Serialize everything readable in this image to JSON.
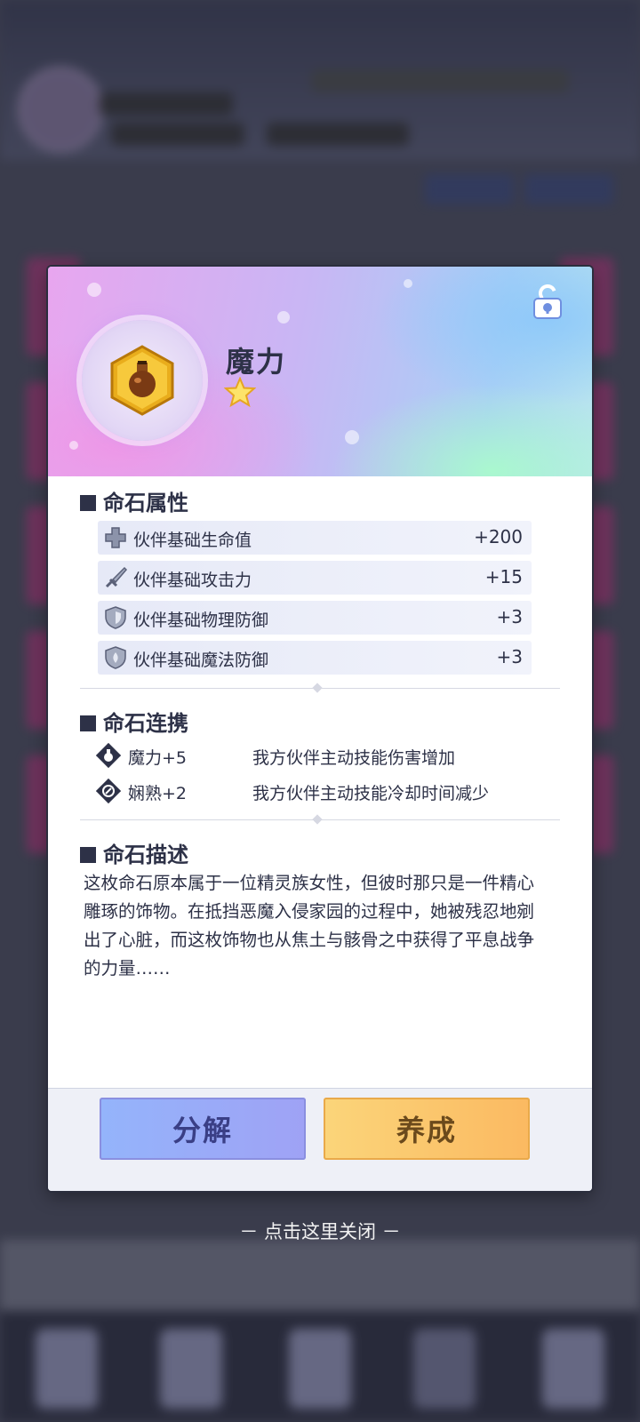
{
  "item": {
    "name": "魔力",
    "stars": 1
  },
  "sections": {
    "attributes_title": "命石属性",
    "links_title": "命石连携",
    "description_title": "命石描述"
  },
  "attributes": [
    {
      "label": "伙伴基础生命值",
      "value": "+200",
      "icon": "plus-icon"
    },
    {
      "label": "伙伴基础攻击力",
      "value": "+15",
      "icon": "sword-icon"
    },
    {
      "label": "伙伴基础物理防御",
      "value": "+3",
      "icon": "shield-icon"
    },
    {
      "label": "伙伴基础魔法防御",
      "value": "+3",
      "icon": "magic-shield-icon"
    }
  ],
  "links": [
    {
      "name": "魔力+5",
      "desc": "我方伙伴主动技能伤害增加",
      "icon": "potion-icon"
    },
    {
      "name": "娴熟+2",
      "desc": "我方伙伴主动技能冷却时间减少",
      "icon": "wrench-icon"
    }
  ],
  "description": "这枚命石原本属于一位精灵族女性，但彼时那只是一件精心雕琢的饰物。在抵挡恶魔入侵家园的过程中，她被残忍地剜出了心脏，而这枚饰物也从焦土与骸骨之中获得了平息战争的力量……",
  "buttons": {
    "decompose": "分解",
    "develop": "养成"
  },
  "close_hint": "－ 点击这里关闭 －",
  "colors": {
    "text": "#2d3147",
    "decompose_button": "#9fa2f5",
    "develop_button": "#fbb961"
  }
}
